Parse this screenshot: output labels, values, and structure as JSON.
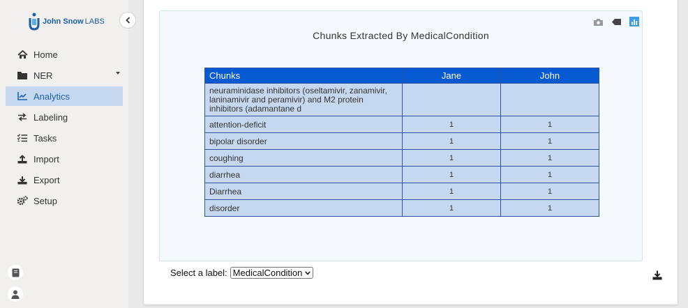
{
  "brand": {
    "name": "John Snow",
    "suffix": "LABS"
  },
  "nav": {
    "items": [
      {
        "label": "Home",
        "icon": "home-icon"
      },
      {
        "label": "NER",
        "icon": "folder-icon",
        "has_dropdown": true
      },
      {
        "label": "Analytics",
        "icon": "chart-line-icon",
        "active": true
      },
      {
        "label": "Labeling",
        "icon": "exchange-icon"
      },
      {
        "label": "Tasks",
        "icon": "tasks-icon"
      },
      {
        "label": "Import",
        "icon": "upload-icon"
      },
      {
        "label": "Export",
        "icon": "download-icon"
      },
      {
        "label": "Setup",
        "icon": "cogs-icon"
      }
    ]
  },
  "chart": {
    "title": "Chunks Extracted By MedicalCondition",
    "toolbar": [
      "camera-icon",
      "tag-icon",
      "bar-chart-icon"
    ]
  },
  "chart_data": {
    "type": "table",
    "title": "Chunks Extracted By MedicalCondition",
    "columns": [
      "Chunks",
      "Jane",
      "John"
    ],
    "rows": [
      [
        "neuraminidase inhibitors (oseltamivir, zanamivir, laninamivir and peramivir) and M2 protein inhibitors (adamantane d",
        "",
        ""
      ],
      [
        "attention-deficit",
        "1",
        "1"
      ],
      [
        "bipolar disorder",
        "1",
        "1"
      ],
      [
        "coughing",
        "1",
        "1"
      ],
      [
        "diarrhea",
        "1",
        "1"
      ],
      [
        "Diarrhea",
        "1",
        "1"
      ],
      [
        "disorder",
        "1",
        "1"
      ]
    ]
  },
  "label_select": {
    "prompt": "Select a label:",
    "value": "MedicalCondition"
  },
  "colors": {
    "accent": "#075ad2",
    "row_bg": "#c6d8ef",
    "active_nav": "#c6d8ef"
  }
}
